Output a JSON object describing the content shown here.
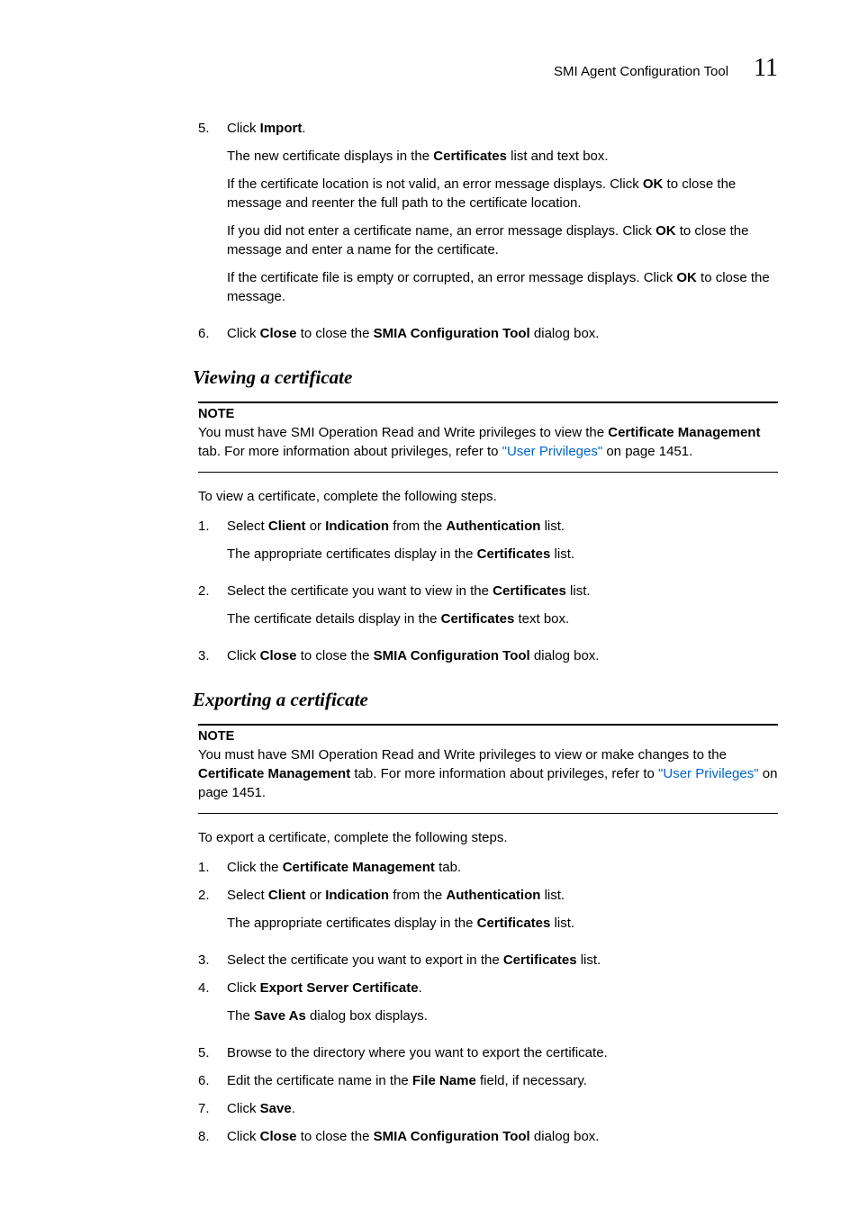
{
  "header": {
    "title": "SMI Agent Configuration Tool",
    "chapter_number": "11"
  },
  "top_steps": [
    {
      "num": "5.",
      "segments": [
        {
          "t": "Click "
        },
        {
          "t": "Import",
          "b": true
        },
        {
          "t": "."
        }
      ],
      "subs": [
        [
          {
            "t": "The new certificate displays in the "
          },
          {
            "t": "Certificates",
            "b": true
          },
          {
            "t": " list and text box."
          }
        ],
        [
          {
            "t": "If the certificate location is not valid, an error message displays. Click "
          },
          {
            "t": "OK",
            "b": true
          },
          {
            "t": " to close the message and reenter the full path to the certificate location."
          }
        ],
        [
          {
            "t": "If you did not enter a certificate name, an error message displays. Click "
          },
          {
            "t": "OK",
            "b": true
          },
          {
            "t": " to close the message and enter a name for the certificate."
          }
        ],
        [
          {
            "t": "If the certificate file is empty or corrupted, an error message displays. Click "
          },
          {
            "t": "OK",
            "b": true
          },
          {
            "t": " to close the message."
          }
        ]
      ]
    },
    {
      "num": "6.",
      "segments": [
        {
          "t": "Click "
        },
        {
          "t": "Close",
          "b": true
        },
        {
          "t": " to close the "
        },
        {
          "t": "SMIA Configuration Tool",
          "b": true
        },
        {
          "t": " dialog box."
        }
      ],
      "subs": []
    }
  ],
  "viewing": {
    "heading": "Viewing a certificate",
    "note_label": "NOTE",
    "note_segments": [
      {
        "t": "You must have SMI Operation Read and Write privileges to view the "
      },
      {
        "t": "Certificate Management",
        "b": true
      },
      {
        "t": " tab. For more information about privileges, refer to "
      },
      {
        "t": "\"User Privileges\"",
        "link": true
      },
      {
        "t": " on page 1451."
      }
    ],
    "intro": "To view a certificate, complete the following steps.",
    "steps": [
      {
        "num": "1.",
        "segments": [
          {
            "t": "Select "
          },
          {
            "t": "Client",
            "b": true
          },
          {
            "t": " or "
          },
          {
            "t": "Indication",
            "b": true
          },
          {
            "t": " from the "
          },
          {
            "t": "Authentication",
            "b": true
          },
          {
            "t": " list."
          }
        ],
        "subs": [
          [
            {
              "t": "The appropriate certificates display in the "
            },
            {
              "t": "Certificates",
              "b": true
            },
            {
              "t": " list."
            }
          ]
        ]
      },
      {
        "num": "2.",
        "segments": [
          {
            "t": "Select the certificate you want to view in the "
          },
          {
            "t": "Certificates",
            "b": true
          },
          {
            "t": " list."
          }
        ],
        "subs": [
          [
            {
              "t": "The certificate details display in the "
            },
            {
              "t": "Certificates",
              "b": true
            },
            {
              "t": " text box."
            }
          ]
        ]
      },
      {
        "num": "3.",
        "segments": [
          {
            "t": "Click "
          },
          {
            "t": "Close",
            "b": true
          },
          {
            "t": " to close the "
          },
          {
            "t": "SMIA Configuration Tool",
            "b": true
          },
          {
            "t": " dialog box."
          }
        ],
        "subs": []
      }
    ]
  },
  "exporting": {
    "heading": "Exporting a certificate",
    "note_label": "NOTE",
    "note_segments": [
      {
        "t": "You must have SMI Operation Read and Write privileges to view or make changes to the "
      },
      {
        "t": "Certificate Management",
        "b": true
      },
      {
        "t": " tab. For more information about privileges, refer to "
      },
      {
        "t": "\"User Privileges\"",
        "link": true
      },
      {
        "t": " on page 1451."
      }
    ],
    "intro": "To export a certificate, complete the following steps.",
    "steps": [
      {
        "num": "1.",
        "segments": [
          {
            "t": "Click the "
          },
          {
            "t": "Certificate Management",
            "b": true
          },
          {
            "t": " tab."
          }
        ],
        "subs": []
      },
      {
        "num": "2.",
        "segments": [
          {
            "t": "Select "
          },
          {
            "t": "Client",
            "b": true
          },
          {
            "t": " or "
          },
          {
            "t": "Indication",
            "b": true
          },
          {
            "t": " from the "
          },
          {
            "t": "Authentication",
            "b": true
          },
          {
            "t": " list."
          }
        ],
        "subs": [
          [
            {
              "t": "The appropriate certificates display in the "
            },
            {
              "t": "Certificates",
              "b": true
            },
            {
              "t": " list."
            }
          ]
        ]
      },
      {
        "num": "3.",
        "segments": [
          {
            "t": "Select the certificate you want to export in the "
          },
          {
            "t": "Certificates",
            "b": true
          },
          {
            "t": " list."
          }
        ],
        "subs": []
      },
      {
        "num": "4.",
        "segments": [
          {
            "t": "Click "
          },
          {
            "t": "Export Server Certificate",
            "b": true
          },
          {
            "t": "."
          }
        ],
        "subs": [
          [
            {
              "t": "The "
            },
            {
              "t": "Save As",
              "b": true
            },
            {
              "t": " dialog box displays."
            }
          ]
        ]
      },
      {
        "num": "5.",
        "segments": [
          {
            "t": "Browse to the directory where you want to export the certificate."
          }
        ],
        "subs": []
      },
      {
        "num": "6.",
        "segments": [
          {
            "t": "Edit the certificate name in the "
          },
          {
            "t": "File Name",
            "b": true
          },
          {
            "t": " field, if necessary."
          }
        ],
        "subs": []
      },
      {
        "num": "7.",
        "segments": [
          {
            "t": "Click "
          },
          {
            "t": "Save",
            "b": true
          },
          {
            "t": "."
          }
        ],
        "subs": []
      },
      {
        "num": "8.",
        "segments": [
          {
            "t": "Click "
          },
          {
            "t": "Close",
            "b": true
          },
          {
            "t": " to close the "
          },
          {
            "t": "SMIA Configuration Tool",
            "b": true
          },
          {
            "t": " dialog box."
          }
        ],
        "subs": []
      }
    ]
  }
}
